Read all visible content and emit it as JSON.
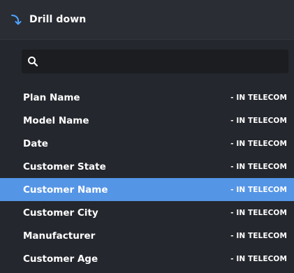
{
  "header": {
    "title": "Drill down",
    "icon": "drill-down-arrow-icon",
    "accent_color": "#4da3ff"
  },
  "search": {
    "value": "",
    "placeholder": "",
    "icon": "search-icon"
  },
  "list": {
    "selected_index": 4,
    "selected_color": "#5595e6",
    "items": [
      {
        "label": "Plan Name",
        "source": "- IN TELECOM"
      },
      {
        "label": "Model Name",
        "source": "- IN TELECOM"
      },
      {
        "label": "Date",
        "source": "- IN TELECOM"
      },
      {
        "label": "Customer State",
        "source": "- IN TELECOM"
      },
      {
        "label": "Customer Name",
        "source": "- IN TELECOM"
      },
      {
        "label": "Customer City",
        "source": "- IN TELECOM"
      },
      {
        "label": "Manufacturer",
        "source": "- IN TELECOM"
      },
      {
        "label": "Customer Age",
        "source": "- IN TELECOM"
      }
    ]
  }
}
